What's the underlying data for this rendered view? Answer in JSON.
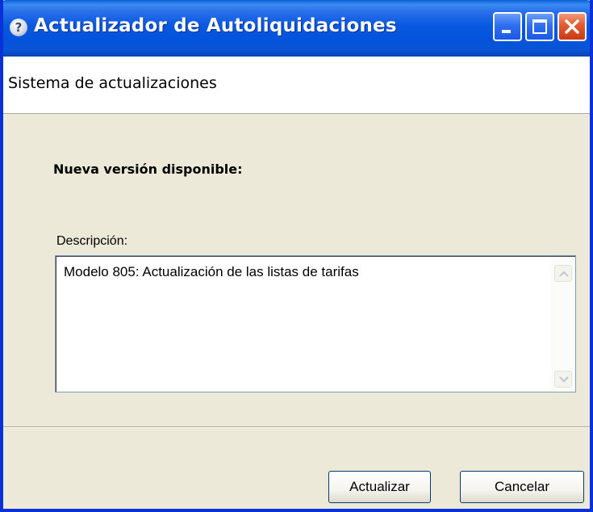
{
  "window": {
    "title": "Actualizador de Autoliquidaciones",
    "title_icon_glyph": "?",
    "controls": {
      "minimize": "minimize-icon",
      "maximize": "maximize-icon",
      "close": "close-icon"
    }
  },
  "header": {
    "title": "Sistema de actualizaciones"
  },
  "content": {
    "new_version_label": "Nueva versión disponible:",
    "description_label": "Descripción:",
    "description_text": "Modelo 805: Actualización de las listas de tarifas"
  },
  "buttons": {
    "update_label": "Actualizar",
    "cancel_label": "Cancelar"
  },
  "colors": {
    "titlebar_blue": "#0453dd",
    "close_red": "#e35a2f",
    "dialog_background": "#ece9d8",
    "header_background": "#ffffff"
  }
}
